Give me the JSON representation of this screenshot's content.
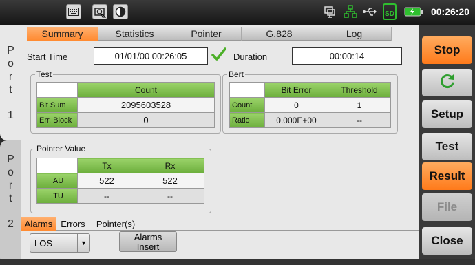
{
  "statusbar": {
    "clock": "00:26:20",
    "icons": [
      "keyboard-icon",
      "screenshot-icon",
      "contrast-icon",
      "network-monitor-icon",
      "lan-icon",
      "usb-icon",
      "sd-card-icon",
      "battery-icon"
    ],
    "sd_label": "SD"
  },
  "ports": [
    {
      "letters": [
        "P",
        "o",
        "r",
        "t"
      ],
      "number": "1",
      "active": true
    },
    {
      "letters": [
        "P",
        "o",
        "r",
        "t"
      ],
      "number": "2",
      "active": false
    }
  ],
  "tabs": [
    {
      "label": "Summary",
      "active": true
    },
    {
      "label": "Statistics",
      "active": false
    },
    {
      "label": "Pointer",
      "active": false
    },
    {
      "label": "G.828",
      "active": false
    },
    {
      "label": "Log",
      "active": false
    }
  ],
  "summary": {
    "start_time_label": "Start Time",
    "start_time_value": "01/01/00 00:26:05",
    "duration_label": "Duration",
    "duration_value": "00:00:14"
  },
  "test": {
    "title": "Test",
    "header": "Count",
    "rows": [
      {
        "label": "Bit Sum",
        "value": "2095603528"
      },
      {
        "label": "Err. Block",
        "value": "0"
      }
    ]
  },
  "bert": {
    "title": "Bert",
    "headers": [
      "Bit Error",
      "Threshold"
    ],
    "rows": [
      {
        "label": "Count",
        "values": [
          "0",
          "1"
        ]
      },
      {
        "label": "Ratio",
        "values": [
          "0.000E+00",
          "--"
        ]
      }
    ]
  },
  "pointer_value": {
    "title": "Pointer Value",
    "headers": [
      "Tx",
      "Rx"
    ],
    "rows": [
      {
        "label": "AU",
        "values": [
          "522",
          "522"
        ]
      },
      {
        "label": "TU",
        "values": [
          "--",
          "--"
        ]
      }
    ]
  },
  "bottom_tabs": [
    {
      "label": "Alarms",
      "active": true
    },
    {
      "label": "Errors",
      "active": false
    },
    {
      "label": "Pointer(s)",
      "active": false
    }
  ],
  "alarm_select": {
    "value": "LOS"
  },
  "alarms_insert": {
    "line1": "Alarms",
    "line2": "Insert"
  },
  "side_buttons": [
    {
      "label": "Stop",
      "style": "orange"
    },
    {
      "label": "",
      "icon": "refresh-icon",
      "style": "gray"
    },
    {
      "label": "Setup",
      "style": "gray"
    },
    {
      "label": "Test",
      "style": "gray"
    },
    {
      "label": "Result",
      "style": "orange"
    },
    {
      "label": "File",
      "style": "disabled"
    },
    {
      "label": "Close",
      "style": "gray"
    }
  ],
  "colors": {
    "accent_orange": "#ff8a30",
    "table_header_green": "#7cbd4a",
    "check_green": "#4caf28",
    "background": "#e8e8e8"
  }
}
